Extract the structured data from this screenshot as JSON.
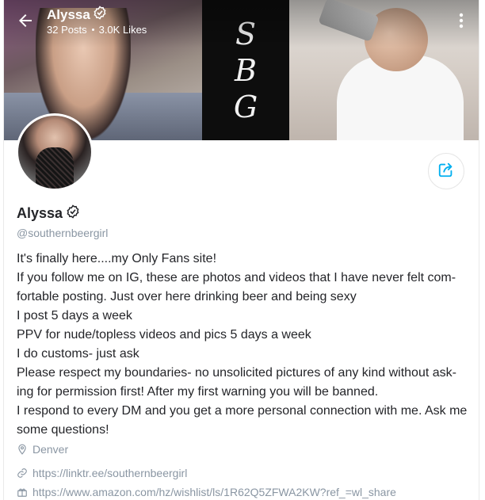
{
  "header": {
    "title": "Alyssa",
    "posts": "32 Posts",
    "likes": "3.0K Likes"
  },
  "cover": {
    "letters": [
      "S",
      "B",
      "G"
    ]
  },
  "profile": {
    "name": "Alyssa",
    "handle": "@southernbeergirl"
  },
  "bio": {
    "lines": [
      "It's finally here....my Only Fans site!",
      "If you follow me on IG, these are photos and videos that I have never felt com-",
      "fortable posting. Just over here drinking beer and being sexy",
      "I post 5 days a week",
      "PPV for nude/topless videos and pics 5 days a week",
      "I do customs- just ask",
      "Please respect my boundaries- no unsolicited pictures of any kind without ask-",
      "ing for permission first! After my first warning you will be banned.",
      "I respond to every DM and you get a more personal connection with me. Ask me",
      "some questions!"
    ]
  },
  "meta": {
    "location": "Denver",
    "link": "https://linktr.ee/southernbeergirl",
    "wishlist": "https://www.amazon.com/hz/wishlist/ls/1R62Q5ZFWA2KW?ref_=wl_share"
  },
  "icons": {
    "back": "arrow-left-icon",
    "more": "more-vertical-icon",
    "verified": "verified-badge-icon",
    "share": "share-icon",
    "location": "location-pin-icon",
    "link": "link-icon",
    "wishlist": "gift-icon"
  },
  "colors": {
    "accent": "#00aff0",
    "muted": "#8a96a3",
    "text": "#242529"
  }
}
